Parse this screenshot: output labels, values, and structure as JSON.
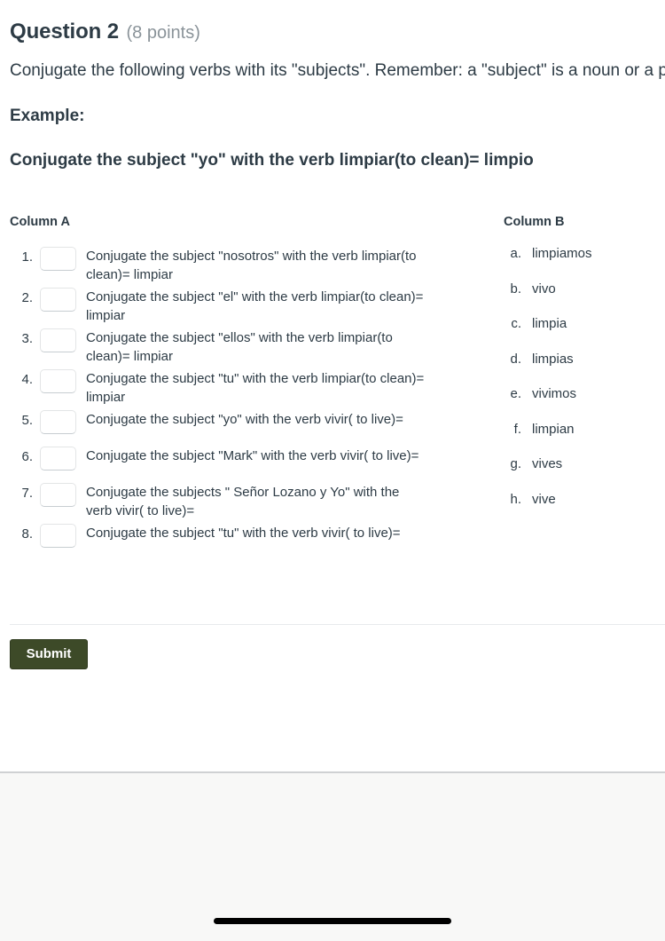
{
  "header": {
    "title": "Question 2",
    "points": "(8 points)"
  },
  "instructions": {
    "line1": "Conjugate the following verbs with its \"subjects\". Remember: a \"subject\" is a noun or a pronoun.",
    "example_label": "Example:",
    "example_text": "Conjugate the  subject \"yo\" with the verb limpiar(to clean)= limpio"
  },
  "matching": {
    "column_a_header": "Column A",
    "column_b_header": "Column B",
    "select_placeholder": "",
    "column_a": [
      {
        "number": "1.",
        "value": "",
        "text": "Conjugate the subject \"nosotros\" with the verb limpiar(to clean)= limpiar"
      },
      {
        "number": "2.",
        "value": "",
        "text": "Conjugate the subject \"el\" with the verb limpiar(to clean)= limpiar"
      },
      {
        "number": "3.",
        "value": "",
        "text": "Conjugate the subject \"ellos\" with the verb limpiar(to clean)= limpiar"
      },
      {
        "number": "4.",
        "value": "",
        "text": "Conjugate the subject \"tu\" with the verb limpiar(to clean)= limpiar"
      },
      {
        "number": "5.",
        "value": "",
        "text": "Conjugate the subject \"yo\" with the verb vivir( to live)="
      },
      {
        "number": "6.",
        "value": "",
        "text": "Conjugate the subject \"Mark\" with the verb vivir( to live)="
      },
      {
        "number": "7.",
        "value": "",
        "text": "Conjugate the subjects \" Señor Lozano y Yo\" with the verb vivir( to live)="
      },
      {
        "number": "8.",
        "value": "",
        "text": "Conjugate the subject \"tu\" with the verb vivir( to live)="
      }
    ],
    "column_b": [
      {
        "letter": "a.",
        "text": "limpiamos"
      },
      {
        "letter": "b.",
        "text": "vivo"
      },
      {
        "letter": "c.",
        "text": "limpia"
      },
      {
        "letter": "d.",
        "text": "limpias"
      },
      {
        "letter": "e.",
        "text": "vivimos"
      },
      {
        "letter": "f.",
        "text": "limpian"
      },
      {
        "letter": "g.",
        "text": "vives"
      },
      {
        "letter": "h.",
        "text": "vive"
      }
    ]
  },
  "footer": {
    "submit_label": "Submit"
  },
  "colors": {
    "submit_background": "#3d4a28",
    "text": "#2d3b45",
    "points_text": "#8a9399",
    "divider": "#e8eaec",
    "bottom_area": "#f8f8f7"
  }
}
